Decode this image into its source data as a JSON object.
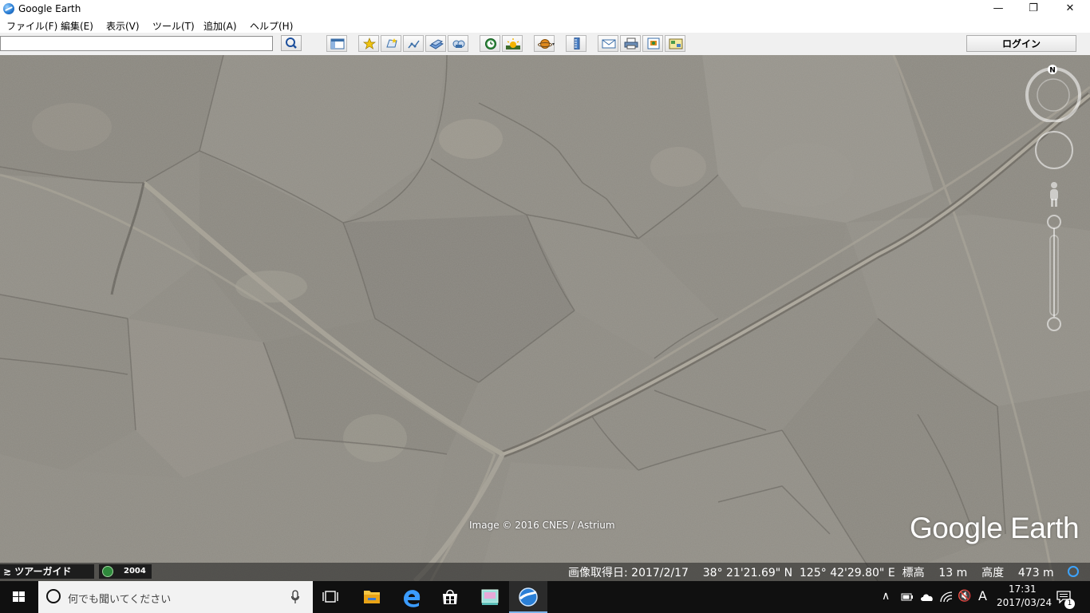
{
  "window": {
    "title": "Google Earth",
    "controls": {
      "minimize": "—",
      "maximize": "❐",
      "close": "✕"
    }
  },
  "menu": [
    "ファイル(F)",
    "編集(E)",
    "表示(V)",
    "ツール(T)",
    "追加(A)",
    "ヘルプ(H)"
  ],
  "search": {
    "value": "",
    "placeholder": ""
  },
  "toolbar": {
    "buttons": [
      "sidebar-toggle",
      "add-placemark",
      "add-polygon",
      "add-path",
      "add-image-overlay",
      "record-tour",
      "historical-imagery",
      "sunlight",
      "switch-planet",
      "ruler",
      "email",
      "print",
      "save-image",
      "view-in-maps"
    ],
    "login_label": "ログイン"
  },
  "map": {
    "attribution": "Image © 2016 CNES / Astrium",
    "logo": "Google Earth",
    "compass_label": "N"
  },
  "status": {
    "tour_guide": "≳ ツアーガイド",
    "history_year": "2004",
    "readout": "画像取得日: 2017/2/17    38° 21'21.69\" N  125° 42'29.80\" E  標高    13 m    高度    473 m"
  },
  "taskbar": {
    "search_placeholder": "何でも聞いてください",
    "tray_ime": "A",
    "clock_time": "17:31",
    "clock_date": "2017/03/24",
    "notifications": "1"
  }
}
